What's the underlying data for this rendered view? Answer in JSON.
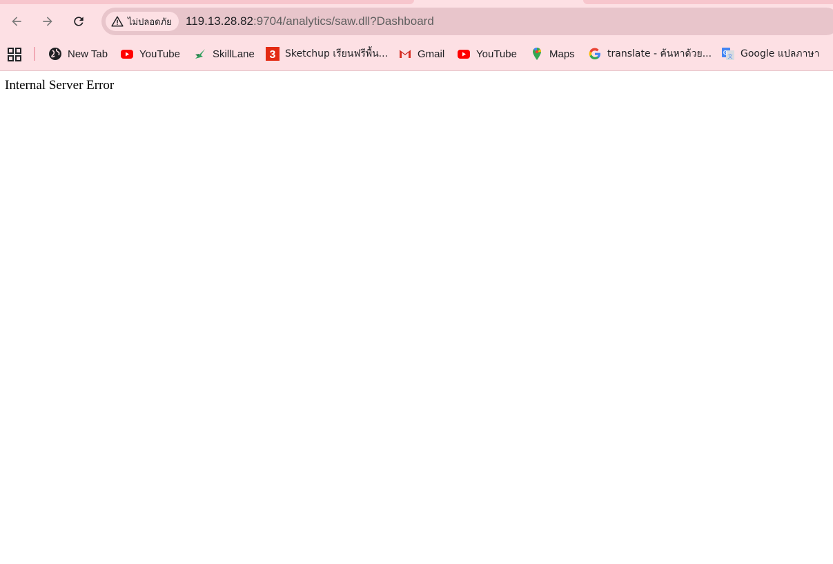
{
  "browser": {
    "nav": {
      "back_icon": "arrow-left-icon",
      "forward_icon": "arrow-right-icon",
      "reload_icon": "reload-icon"
    },
    "omnibox": {
      "security_label": "ไม่ปลอดภัย",
      "security_icon": "warning-triangle-icon",
      "url_host": "119.13.28.82",
      "url_path": ":9704/analytics/saw.dll?Dashboard"
    },
    "bookmarks": [
      {
        "label": "New Tab",
        "icon": "globe-icon"
      },
      {
        "label": "YouTube",
        "icon": "youtube-icon"
      },
      {
        "label": "SkillLane",
        "icon": "skilllane-icon"
      },
      {
        "label": "Sketchup เรียนฟรีพื้น...",
        "icon": "sketchup-3-icon"
      },
      {
        "label": "Gmail",
        "icon": "gmail-icon"
      },
      {
        "label": "YouTube",
        "icon": "youtube-icon"
      },
      {
        "label": "Maps",
        "icon": "maps-pin-icon"
      },
      {
        "label": "translate - ค้นหาด้วย...",
        "icon": "google-g-icon"
      },
      {
        "label": "Google แปลภาษา",
        "icon": "google-translate-icon"
      }
    ],
    "apps_icon": "apps-grid-icon"
  },
  "page": {
    "message": "Internal Server Error"
  },
  "colors": {
    "chrome_bg": "#fde0e4",
    "omnibox_bg": "#e8c5cb",
    "youtube_red": "#ff0000",
    "content_bg": "#ffffff"
  }
}
